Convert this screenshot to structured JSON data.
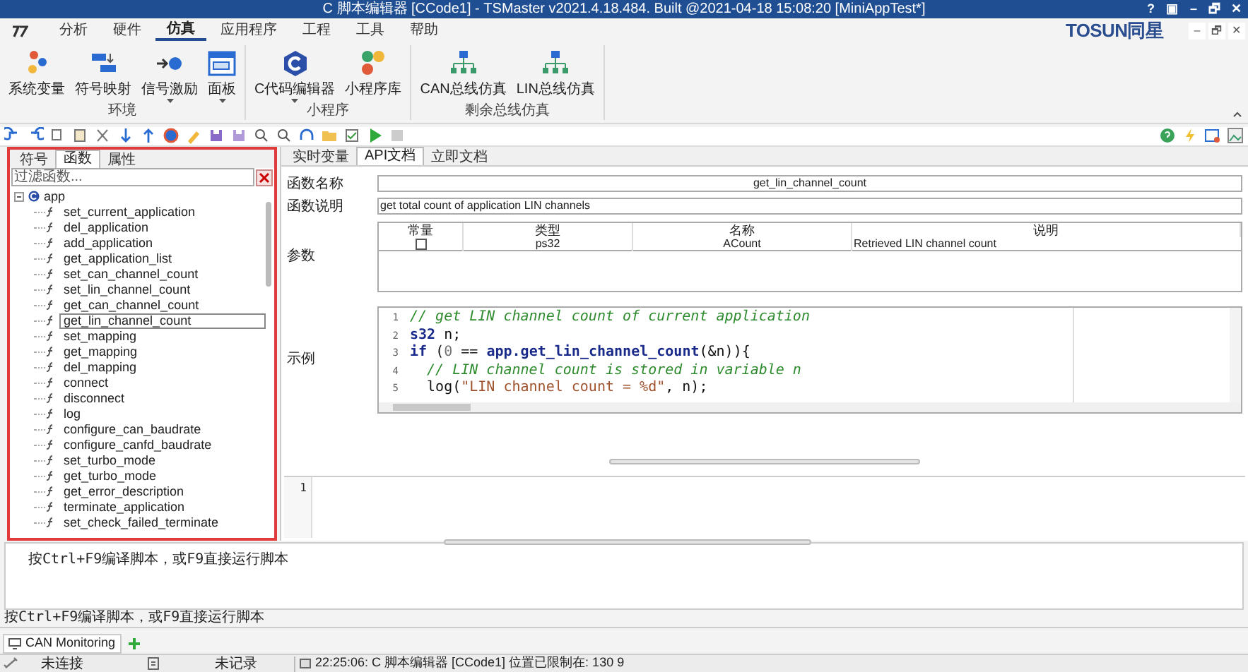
{
  "window": {
    "title": "C 脚本编辑器 [CCode1] - TSMaster v2021.4.18.484. Built @2021-04-18 15:08:20 [MiniAppTest*]",
    "title_buttons": [
      "?",
      "▣",
      "–",
      "🗗",
      "✕"
    ]
  },
  "menu": {
    "items": [
      {
        "label": "分析",
        "selected": false
      },
      {
        "label": "硬件",
        "selected": false
      },
      {
        "label": "仿真",
        "selected": true
      },
      {
        "label": "应用程序",
        "selected": false
      },
      {
        "label": "工程",
        "selected": false
      },
      {
        "label": "工具",
        "selected": false
      },
      {
        "label": "帮助",
        "selected": false
      }
    ],
    "brand": "TOSUN同星",
    "mdi_buttons": [
      "–",
      "🗗",
      "✕"
    ]
  },
  "ribbon": {
    "groups": [
      {
        "label": "环境",
        "buttons": [
          {
            "label": "系统变量",
            "dropdown": false
          },
          {
            "label": "符号映射",
            "dropdown": false
          },
          {
            "label": "信号激励",
            "dropdown": true
          },
          {
            "label": "面板",
            "dropdown": true
          }
        ]
      },
      {
        "label": "小程序",
        "buttons": [
          {
            "label": "C代码编辑器",
            "dropdown": true
          },
          {
            "label": "小程序库",
            "dropdown": false
          }
        ]
      },
      {
        "label": "剩余总线仿真",
        "buttons": [
          {
            "label": "CAN总线仿真",
            "dropdown": false
          },
          {
            "label": "LIN总线仿真",
            "dropdown": false
          }
        ]
      }
    ]
  },
  "left_panel": {
    "tabs": [
      {
        "label": "符号",
        "selected": false
      },
      {
        "label": "函数",
        "selected": true
      },
      {
        "label": "属性",
        "selected": false
      }
    ],
    "filter": {
      "placeholder": "过滤函数..."
    },
    "tree": [
      {
        "label": "app",
        "expanded": true,
        "children": [
          {
            "label": "set_current_application",
            "selected": false
          },
          {
            "label": "del_application",
            "selected": false
          },
          {
            "label": "add_application",
            "selected": false
          },
          {
            "label": "get_application_list",
            "selected": false
          },
          {
            "label": "set_can_channel_count",
            "selected": false
          },
          {
            "label": "set_lin_channel_count",
            "selected": false
          },
          {
            "label": "get_can_channel_count",
            "selected": false
          },
          {
            "label": "get_lin_channel_count",
            "selected": true
          },
          {
            "label": "set_mapping",
            "selected": false
          },
          {
            "label": "get_mapping",
            "selected": false
          },
          {
            "label": "del_mapping",
            "selected": false
          },
          {
            "label": "connect",
            "selected": false
          },
          {
            "label": "disconnect",
            "selected": false
          },
          {
            "label": "log",
            "selected": false
          },
          {
            "label": "configure_can_baudrate",
            "selected": false
          },
          {
            "label": "configure_canfd_baudrate",
            "selected": false
          },
          {
            "label": "set_turbo_mode",
            "selected": false
          },
          {
            "label": "get_turbo_mode",
            "selected": false
          },
          {
            "label": "get_error_description",
            "selected": false
          },
          {
            "label": "terminate_application",
            "selected": false
          },
          {
            "label": "set_check_failed_terminate",
            "selected": false
          }
        ]
      }
    ]
  },
  "doc_panel": {
    "tabs": [
      {
        "label": "实时变量",
        "selected": false
      },
      {
        "label": "API文档",
        "selected": true
      },
      {
        "label": "立即文档",
        "selected": false
      }
    ],
    "function_name": {
      "label": "函数名称",
      "value": "get_lin_channel_count"
    },
    "function_desc": {
      "label": "函数说明",
      "value": "get total count of application LIN channels"
    },
    "params": {
      "label": "参数",
      "columns": [
        "常量",
        "类型",
        "名称",
        "说明"
      ],
      "rows": [
        {
          "constant": false,
          "type": "ps32",
          "name": "ACount",
          "desc": "Retrieved LIN channel count"
        }
      ]
    },
    "example": {
      "label": "示例",
      "lines": [
        {
          "number": "1",
          "tokens": [
            {
              "kind": "comment",
              "text": "// get LIN channel count of current application"
            }
          ]
        },
        {
          "number": "2",
          "tokens": [
            {
              "kind": "type",
              "text": "s32"
            },
            {
              "kind": "plain",
              "text": " n;"
            }
          ]
        },
        {
          "number": "3",
          "tokens": [
            {
              "kind": "keyword",
              "text": "if"
            },
            {
              "kind": "plain",
              "text": " ("
            },
            {
              "kind": "number",
              "text": "0"
            },
            {
              "kind": "plain",
              "text": " == "
            },
            {
              "kind": "call",
              "text": "app.get_lin_channel_count"
            },
            {
              "kind": "plain",
              "text": "(&n)){"
            }
          ]
        },
        {
          "number": "4",
          "tokens": [
            {
              "kind": "comment",
              "text": "  // LIN channel count is stored in variable n"
            }
          ]
        },
        {
          "number": "5",
          "tokens": [
            {
              "kind": "plain",
              "text": "  log("
            },
            {
              "kind": "string",
              "text": "\"LIN channel count = %d\""
            },
            {
              "kind": "plain",
              "text": ", n);"
            }
          ]
        }
      ]
    }
  },
  "editor": {
    "lines": [
      "1"
    ]
  },
  "output": {
    "text": "按Ctrl+F9编译脚本，或F9直接运行脚本"
  },
  "hint_bar": {
    "text": "按Ctrl+F9编译脚本，或F9直接运行脚本"
  },
  "bottom_tabs": [
    {
      "label": "CAN Monitoring",
      "selected": true
    }
  ],
  "status_bar": {
    "connection": "未连接",
    "recording": "未记录",
    "message": "22:25:06: C 脚本编辑器 [CCode1] 位置已限制在: 130 9"
  }
}
